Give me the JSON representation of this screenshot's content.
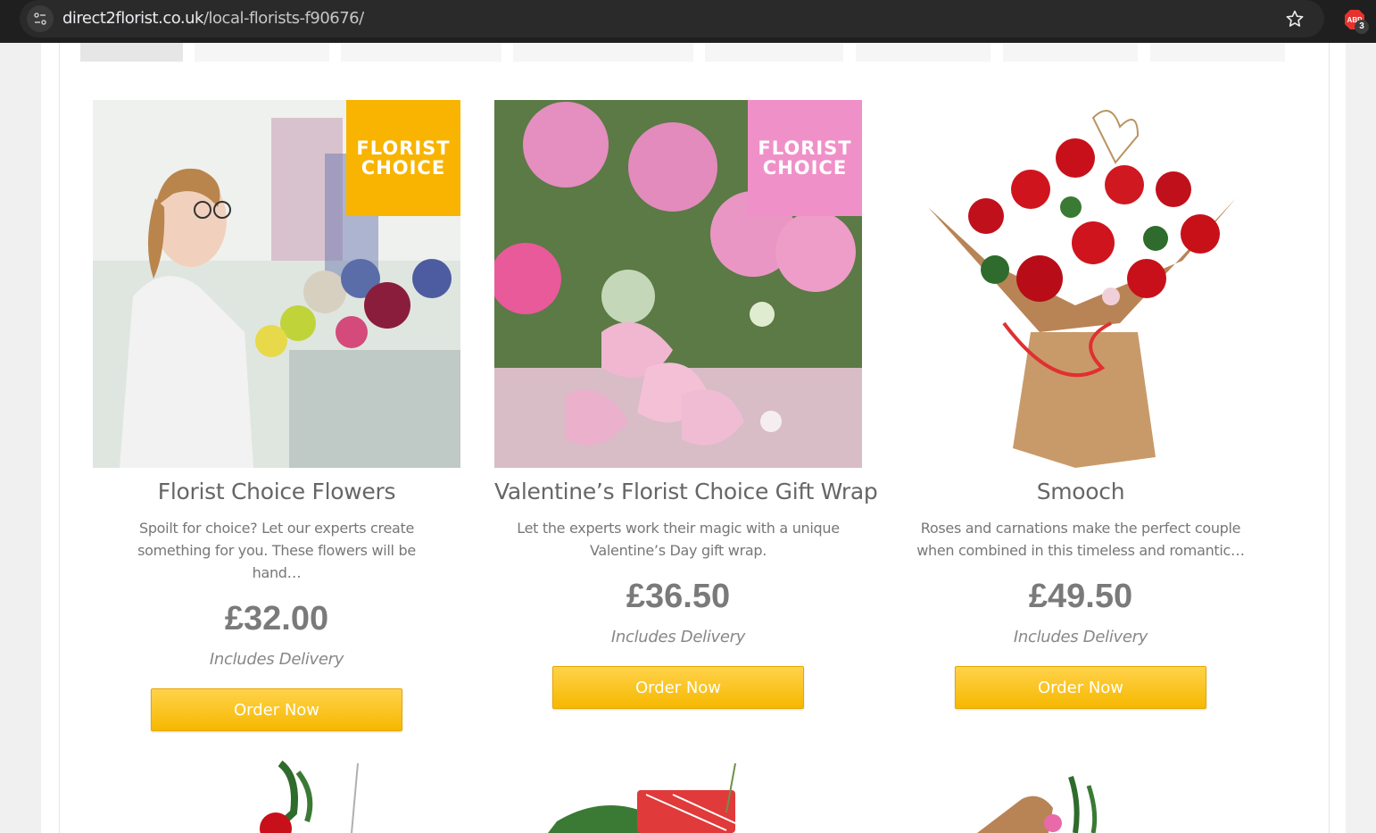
{
  "browser": {
    "url_host": "direct2florist.co.uk",
    "url_path": "/local-florists-f90676/",
    "extension_badge": "3"
  },
  "products": [
    {
      "name": "Florist Choice Flowers",
      "description": "Spoilt for choice? Let our experts create something for you. These flowers will be hand…",
      "price": "£32.00",
      "delivery": "Includes Delivery",
      "button": "Order Now",
      "badge": "FLORIST\nCHOICE",
      "badge_color": "#f8b400"
    },
    {
      "name": "Valentine’s Florist Choice Gift Wrap",
      "description": "Let the experts work their magic with a unique Valentine’s Day gift wrap.",
      "price": "£36.50",
      "delivery": "Includes Delivery",
      "button": "Order Now",
      "badge": "FLORIST\nCHOICE",
      "badge_color": "#f090c8"
    },
    {
      "name": "Smooch",
      "description": "Roses and carnations make the perfect couple when combined in this timeless and romantic…",
      "price": "£49.50",
      "delivery": "Includes Delivery",
      "button": "Order Now"
    }
  ],
  "colors": {
    "button": "#f6b800",
    "text_grey": "#777777",
    "browser_dark": "#1f1f1f"
  }
}
